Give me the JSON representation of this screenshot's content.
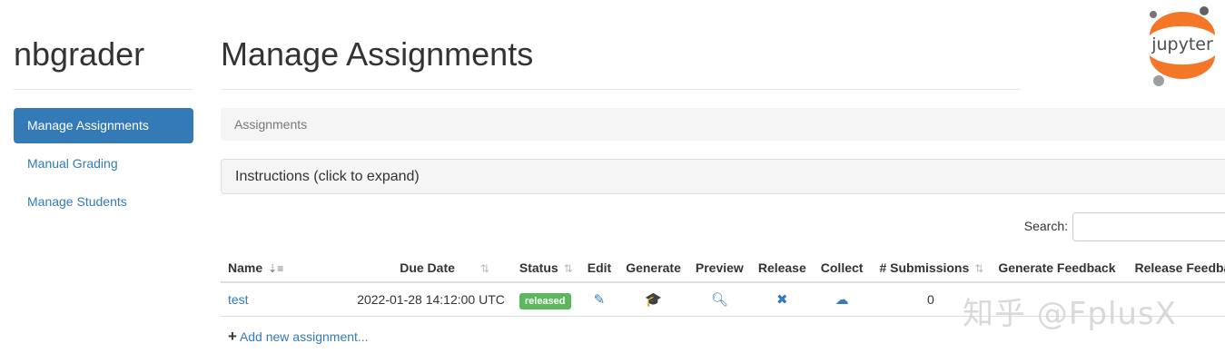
{
  "app": {
    "brand": "nbgrader"
  },
  "sidebar": {
    "items": [
      {
        "label": "Manage Assignments",
        "active": true
      },
      {
        "label": "Manual Grading",
        "active": false
      },
      {
        "label": "Manage Students",
        "active": false
      }
    ]
  },
  "main": {
    "title": "Manage Assignments",
    "breadcrumb": "Assignments",
    "instructions_label": "Instructions (click to expand)",
    "search": {
      "label": "Search:",
      "value": ""
    },
    "table": {
      "headers": [
        "Name",
        "Due Date",
        "Status",
        "Edit",
        "Generate",
        "Preview",
        "Release",
        "Collect",
        "# Submissions",
        "Generate Feedback",
        "Release Feedback"
      ],
      "rows": [
        {
          "name": "test",
          "due_date": "2022-01-28 14:12:00 UTC",
          "status": "released",
          "submissions": "0"
        }
      ]
    },
    "add_link": "Add new assignment..."
  },
  "logo": {
    "text": "jupyter"
  },
  "watermark": "知乎 @FplusX",
  "colors": {
    "primary": "#337ab7",
    "released": "#5cb85c",
    "jupyter_orange": "#f37726"
  }
}
